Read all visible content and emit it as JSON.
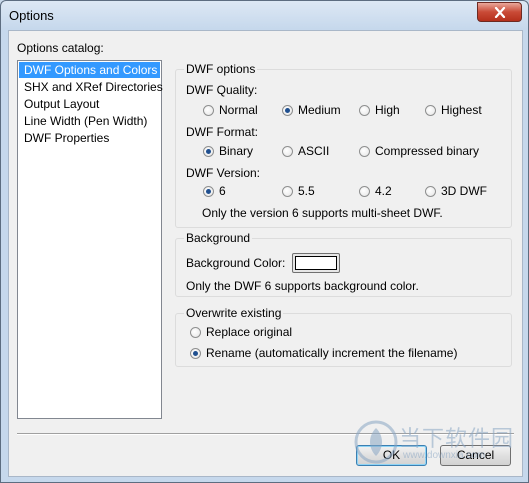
{
  "window": {
    "title": "Options"
  },
  "catalog": {
    "label": "Options catalog:",
    "items": [
      "DWF Options and Colors",
      "SHX and XRef Directories",
      "Output Layout",
      "Line Width (Pen Width)",
      "DWF Properties"
    ],
    "selected": "DWF Options and Colors"
  },
  "dwf_options": {
    "title": "DWF options",
    "quality": {
      "label": "DWF Quality:",
      "options": [
        "Normal",
        "Medium",
        "High",
        "Highest"
      ],
      "selected": "Medium"
    },
    "format": {
      "label": "DWF Format:",
      "options": [
        "Binary",
        "ASCII",
        "Compressed binary"
      ],
      "selected": "Binary"
    },
    "version": {
      "label": "DWF Version:",
      "options": [
        "6",
        "5.5",
        "4.2",
        "3D DWF"
      ],
      "selected": "6"
    },
    "note": "Only the version 6 supports multi-sheet DWF."
  },
  "background": {
    "title": "Background",
    "color_label": "Background Color:",
    "color_value": "#ffffff",
    "note": "Only the DWF 6 supports background color."
  },
  "overwrite": {
    "title": "Overwrite existing",
    "options": [
      "Replace original",
      "Rename (automatically increment the filename)"
    ],
    "selected": "Rename (automatically increment the filename)"
  },
  "buttons": {
    "ok": "OK",
    "cancel": "Cancel"
  },
  "watermark": {
    "text": "当下软件园",
    "url": "www.downxia.com"
  }
}
